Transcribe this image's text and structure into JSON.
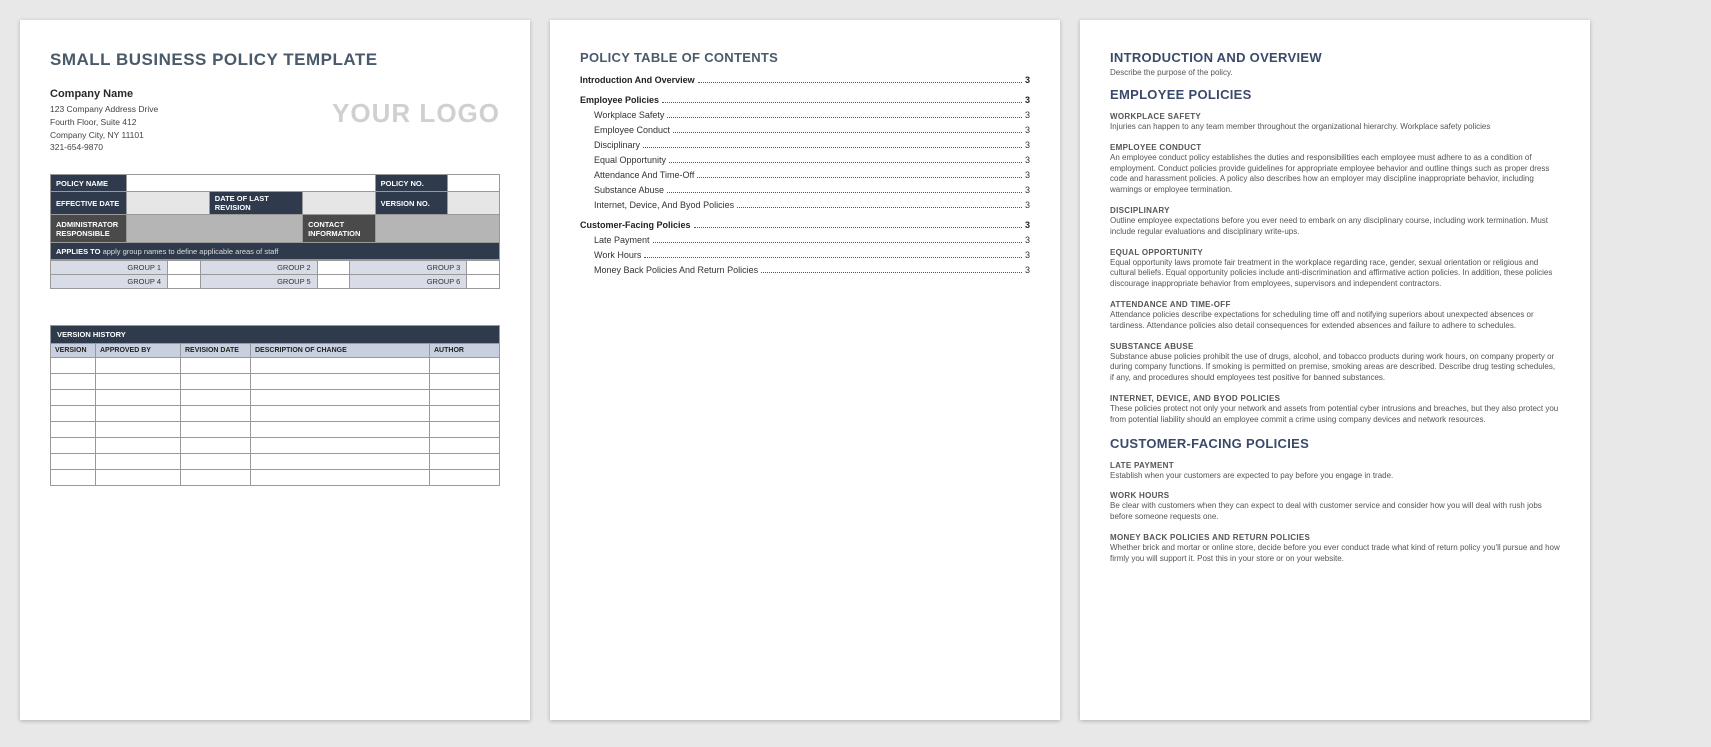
{
  "page1": {
    "title": "SMALL BUSINESS POLICY TEMPLATE",
    "company_name": "Company Name",
    "addr1": "123 Company Address Drive",
    "addr2": "Fourth Floor, Suite 412",
    "addr3": "Company City, NY  11101",
    "phone": "321-654-9870",
    "logo": "YOUR LOGO",
    "labels": {
      "policy_name": "POLICY NAME",
      "policy_no": "POLICY NO.",
      "effective_date": "EFFECTIVE DATE",
      "date_last_revision": "DATE OF LAST REVISION",
      "version_no": "VERSION NO.",
      "admin_responsible": "ADMINISTRATOR RESPONSIBLE",
      "contact_info": "CONTACT INFORMATION",
      "applies_to": "APPLIES TO",
      "applies_desc": "apply group names to define applicable areas of staff"
    },
    "groups": [
      "GROUP 1",
      "GROUP 2",
      "GROUP 3",
      "GROUP 4",
      "GROUP 5",
      "GROUP 6"
    ],
    "version_history": {
      "title": "VERSION HISTORY",
      "cols": [
        "VERSION",
        "APPROVED BY",
        "REVISION DATE",
        "DESCRIPTION OF CHANGE",
        "AUTHOR"
      ]
    }
  },
  "page2": {
    "title": "POLICY TABLE OF CONTENTS",
    "toc": [
      {
        "level": 1,
        "label": "Introduction And Overview",
        "page": "3"
      },
      {
        "level": 1,
        "label": "Employee Policies",
        "page": "3"
      },
      {
        "level": 2,
        "label": "Workplace Safety",
        "page": "3"
      },
      {
        "level": 2,
        "label": "Employee Conduct",
        "page": "3"
      },
      {
        "level": 2,
        "label": "Disciplinary",
        "page": "3"
      },
      {
        "level": 2,
        "label": "Equal Opportunity",
        "page": "3"
      },
      {
        "level": 2,
        "label": "Attendance And Time-Off",
        "page": "3"
      },
      {
        "level": 2,
        "label": "Substance Abuse",
        "page": "3"
      },
      {
        "level": 2,
        "label": "Internet, Device, And Byod Policies",
        "page": "3"
      },
      {
        "level": 1,
        "label": "Customer-Facing Policies",
        "page": "3"
      },
      {
        "level": 2,
        "label": "Late Payment",
        "page": "3"
      },
      {
        "level": 2,
        "label": "Work Hours",
        "page": "3"
      },
      {
        "level": 2,
        "label": "Money Back Policies And Return Policies",
        "page": "3"
      }
    ]
  },
  "page3": {
    "sections": [
      {
        "h1": "INTRODUCTION AND OVERVIEW",
        "desc": "Describe the purpose of the policy.",
        "subs": []
      },
      {
        "h1": "EMPLOYEE POLICIES",
        "desc": "",
        "subs": [
          {
            "h": "WORKPLACE SAFETY",
            "p": "Injuries can happen to any team member throughout the organizational hierarchy. Workplace safety policies"
          },
          {
            "h": "EMPLOYEE CONDUCT",
            "p": "An employee conduct policy establishes the duties and responsibilities each employee must adhere to as a condition of employment. Conduct policies provide guidelines for appropriate employee behavior and outline things such as proper dress code and harassment policies. A policy also describes how an employer may discipline inappropriate behavior, including warnings or employee termination."
          },
          {
            "h": "DISCIPLINARY",
            "p": "Outline employee expectations before you ever need to embark on any disciplinary course, including work termination. Must include regular evaluations and disciplinary write-ups."
          },
          {
            "h": "EQUAL OPPORTUNITY",
            "p": "Equal opportunity laws promote fair treatment in the workplace regarding race, gender, sexual orientation or religious and cultural beliefs. Equal opportunity policies include anti-discrimination and affirmative action policies. In addition, these policies discourage inappropriate behavior from employees, supervisors and independent contractors."
          },
          {
            "h": "ATTENDANCE AND TIME-OFF",
            "p": "Attendance policies describe expectations for scheduling time off and notifying superiors about unexpected absences or tardiness. Attendance policies also detail consequences for extended absences and failure to adhere to schedules."
          },
          {
            "h": "SUBSTANCE ABUSE",
            "p": "Substance abuse policies prohibit the use of drugs, alcohol, and tobacco products during work hours, on company property or during company functions. If smoking is permitted on premise, smoking areas are described. Describe drug testing schedules, if any, and procedures should employees test positive for banned substances."
          },
          {
            "h": "INTERNET, DEVICE, AND BYOD POLICIES",
            "p": "These policies protect not only your network and assets from potential cyber intrusions and breaches, but they also protect you from potential liability should an employee commit a crime using company devices and network resources."
          }
        ]
      },
      {
        "h1": "CUSTOMER-FACING POLICIES",
        "desc": "",
        "subs": [
          {
            "h": "LATE PAYMENT",
            "p": "Establish when your customers are expected to pay before you engage in trade."
          },
          {
            "h": "WORK HOURS",
            "p": "Be clear with customers when they can expect to deal with customer service and consider how you will deal with rush jobs before someone requests one."
          },
          {
            "h": "MONEY BACK POLICIES AND RETURN POLICIES",
            "p": "Whether brick and mortar or online store, decide before you ever conduct trade what kind of return policy you'll pursue and how firmly you will support it. Post this in your store or on your website."
          }
        ]
      }
    ]
  }
}
